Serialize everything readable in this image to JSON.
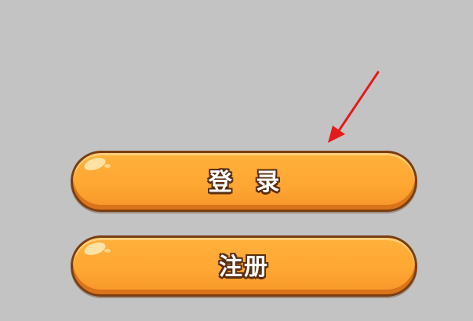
{
  "buttons": {
    "login_label": "登 录",
    "register_label": "注册"
  },
  "colors": {
    "background": "#c3c3c3",
    "button_fill": "#ffa733",
    "button_border": "#7a3e12",
    "label_outline": "#5a2e10",
    "arrow": "#e31b1b"
  },
  "icons": {
    "annotation": "red-arrow-icon"
  }
}
